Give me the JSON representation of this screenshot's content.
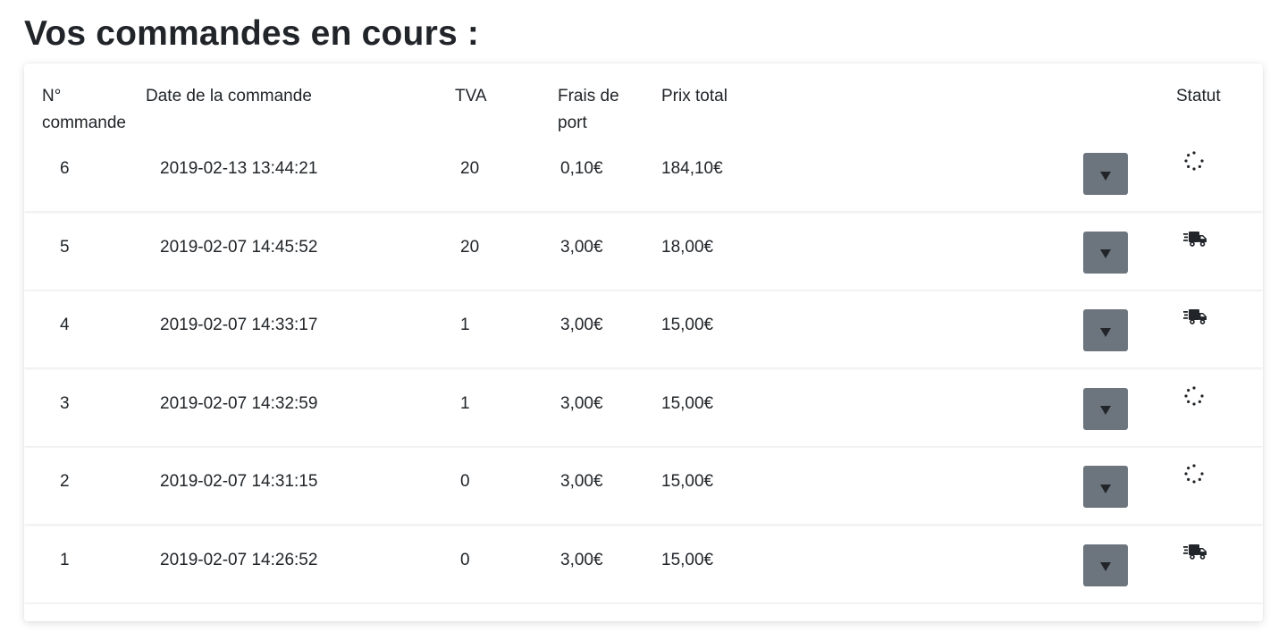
{
  "page": {
    "title": "Vos commandes en cours :"
  },
  "table": {
    "headers": {
      "num": "N° commande",
      "date": "Date de la commande",
      "tva": "TVA",
      "frais": "Frais de port",
      "prix": "Prix total",
      "statut": "Statut"
    },
    "rows": [
      {
        "num": "6",
        "date": "2019-02-13 13:44:21",
        "tva": "20",
        "frais": "0,10€",
        "prix": "184,10€",
        "status_icon": "spinner-icon"
      },
      {
        "num": "5",
        "date": "2019-02-07 14:45:52",
        "tva": "20",
        "frais": "3,00€",
        "prix": "18,00€",
        "status_icon": "shipping-fast-icon"
      },
      {
        "num": "4",
        "date": "2019-02-07 14:33:17",
        "tva": "1",
        "frais": "3,00€",
        "prix": "15,00€",
        "status_icon": "shipping-fast-icon"
      },
      {
        "num": "3",
        "date": "2019-02-07 14:32:59",
        "tva": "1",
        "frais": "3,00€",
        "prix": "15,00€",
        "status_icon": "spinner-icon"
      },
      {
        "num": "2",
        "date": "2019-02-07 14:31:15",
        "tva": "0",
        "frais": "3,00€",
        "prix": "15,00€",
        "status_icon": "spinner-icon"
      },
      {
        "num": "1",
        "date": "2019-02-07 14:26:52",
        "tva": "0",
        "frais": "3,00€",
        "prix": "15,00€",
        "status_icon": "shipping-fast-icon"
      }
    ]
  },
  "colors": {
    "button_bg": "#6c757d",
    "text": "#212529"
  }
}
